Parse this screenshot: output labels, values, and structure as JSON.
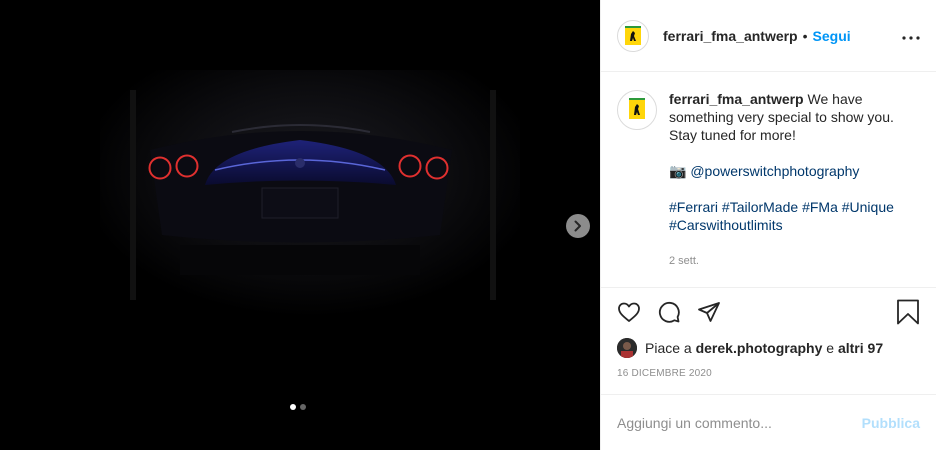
{
  "post": {
    "username": "ferrari_fma_antwerp",
    "follow_label": "Segui",
    "separator": "•",
    "more_label": "•••"
  },
  "caption": {
    "username": "ferrari_fma_antwerp",
    "text_line1": " We have something very special to show you. Stay tuned for more!",
    "camera_emoji": "📷",
    "photographer": "@powerswitchphotography",
    "hashtags": [
      "#Ferrari",
      "#TailorMade",
      "#FMa",
      "#Unique",
      "#Carswithoutlimits"
    ],
    "time_ago": "2 sett."
  },
  "likes": {
    "prefix": "Piace a ",
    "user": "derek.photography",
    "middle": " e ",
    "others": "altri 97"
  },
  "date": "16 dicembre 2020",
  "composer": {
    "placeholder": "Aggiungi un commento...",
    "publish_label": "Pubblica"
  },
  "carousel": {
    "total": 2,
    "active": 1
  },
  "icons": {
    "like": "heart-icon",
    "comment": "comment-bubble-icon",
    "share": "paper-plane-icon",
    "save": "bookmark-icon",
    "next": "chevron-right-icon"
  },
  "colors": {
    "accent": "#0095f6",
    "publish_disabled": "#b2dffc",
    "muted": "#8e8e8e",
    "taillight": "#e0302f",
    "body_blue": "#1a1f6b"
  }
}
